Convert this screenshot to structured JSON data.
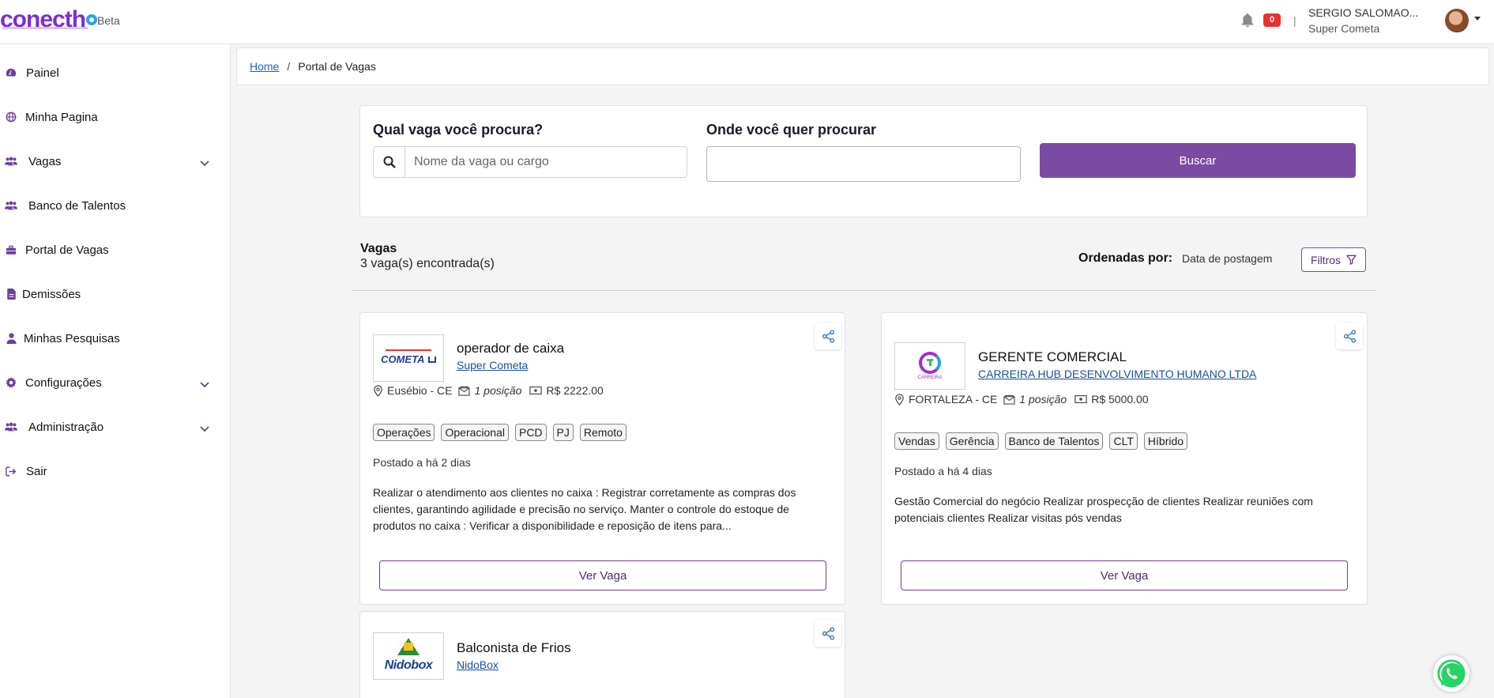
{
  "header": {
    "logo_text": "conecth",
    "beta_label": "Beta",
    "notification_count": "0",
    "separator": "|",
    "user_name": "SERGIO SALOMAO...",
    "user_company": "Super Cometa"
  },
  "sidebar": {
    "items": [
      {
        "label": "Painel",
        "icon": "dashboard-icon"
      },
      {
        "label": "Minha Pagina",
        "icon": "globe-icon"
      },
      {
        "label": "Vagas",
        "icon": "users-icon"
      },
      {
        "label": "Banco de Talentos",
        "icon": "users-icon"
      },
      {
        "label": "Portal de Vagas",
        "icon": "briefcase-icon"
      },
      {
        "label": "Demissões",
        "icon": "file-icon"
      },
      {
        "label": "Minhas Pesquisas",
        "icon": "user-icon"
      },
      {
        "label": "Configurações",
        "icon": "gear-icon"
      },
      {
        "label": "Administração",
        "icon": "users-icon"
      },
      {
        "label": "Sair",
        "icon": "sign-out-icon"
      }
    ]
  },
  "breadcrumb": {
    "home": "Home",
    "separator": "/",
    "current": "Portal de Vagas"
  },
  "search": {
    "what_label": "Qual vaga você procura?",
    "what_placeholder": "Nome da vaga ou cargo",
    "what_value": "",
    "where_label": "Onde você quer procurar",
    "where_value": "",
    "button_label": "Buscar"
  },
  "results": {
    "title": "Vagas",
    "count_text": "3 vaga(s) encontrada(s)",
    "order_label": "Ordenadas por:",
    "order_value": "Data de postagem",
    "filters_label": "Filtros"
  },
  "jobs": [
    {
      "title": "operador de caixa",
      "company": "Super Cometa",
      "logo_text": "COMETA",
      "location": "Eusébio - CE",
      "positions": "1 posição",
      "salary": "R$ 2222.00",
      "tags": [
        "Operações",
        "Operacional",
        "PCD",
        "PJ",
        "Remoto"
      ],
      "posted": "Postado a há 2 dias",
      "description": "Realizar o atendimento aos clientes no caixa : Registrar corretamente as compras dos clientes, garantindo agilidade e precisão no serviço. Manter o controle do estoque de produtos no caixa : Verificar a disponibilidade e reposição de itens para...",
      "button_label": "Ver Vaga"
    },
    {
      "title": "GERENTE COMERCIAL",
      "company": "CARREIRA HUB DESENVOLVIMENTO HUMANO LTDA",
      "logo_text": "CARREIRA",
      "location": "FORTALEZA - CE",
      "positions": "1 posição",
      "salary": "R$ 5000.00",
      "tags": [
        "Vendas",
        "Gerência",
        "Banco de Talentos",
        "CLT",
        "Híbrido"
      ],
      "posted": "Postado a há 4 dias",
      "description": "Gestão Comercial do negócio Realizar prospecção de clientes Realizar reuniões com potenciais clientes Realizar visitas pós vendas",
      "button_label": "Ver Vaga"
    },
    {
      "title": "Balconista de Frios",
      "company": "NidoBox",
      "logo_text": "Nidobox"
    }
  ],
  "colors": {
    "primary": "#7b4ba3",
    "logo": "#7b2fd0",
    "badge": "#e8312b",
    "link": "#1a5fd0",
    "whatsapp": "#25d366"
  }
}
